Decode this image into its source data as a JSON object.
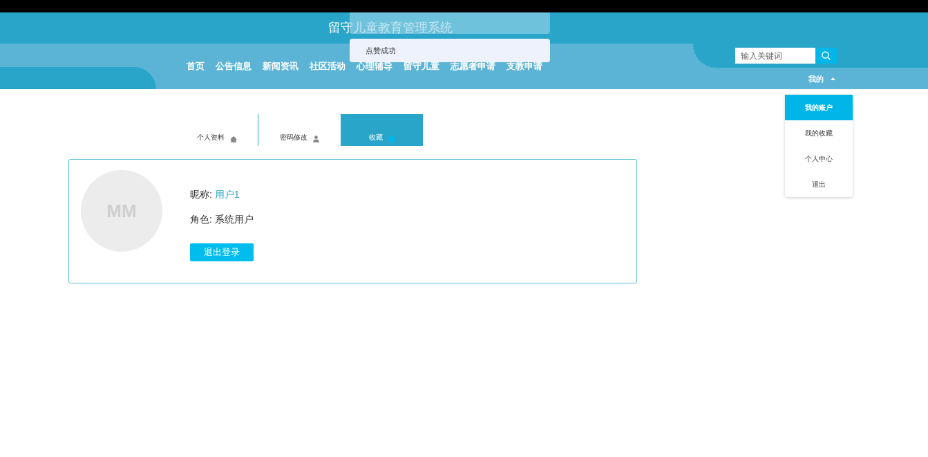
{
  "header": {
    "title": "留守儿童教育管理系统",
    "nav": [
      {
        "label": "首页"
      },
      {
        "label": "公告信息"
      },
      {
        "label": "新闻资讯"
      },
      {
        "label": "社区活动"
      },
      {
        "label": "心理辅导"
      },
      {
        "label": "留守儿童"
      },
      {
        "label": "志愿者申请"
      },
      {
        "label": "支教申请"
      }
    ],
    "search": {
      "placeholder": "输入关键词"
    },
    "user_menu": {
      "label": "我的",
      "expanded": true,
      "items": [
        {
          "label": "我的账户",
          "selected": true
        },
        {
          "label": "我的收藏",
          "selected": false
        },
        {
          "label": "个人中心",
          "selected": false
        },
        {
          "label": "退出",
          "selected": false
        }
      ]
    }
  },
  "toasts": [
    {
      "text": "点赞成功"
    }
  ],
  "tabs": [
    {
      "label": "个人资料",
      "selected": false
    },
    {
      "label": "密码修改",
      "selected": false
    },
    {
      "label": "收藏",
      "selected": true
    }
  ],
  "profile": {
    "avatar": "MM",
    "nickname_label": "昵称:",
    "nickname": "用户1",
    "role_label": "角色:",
    "role": "系统用户",
    "logout_button": "退出登录"
  }
}
